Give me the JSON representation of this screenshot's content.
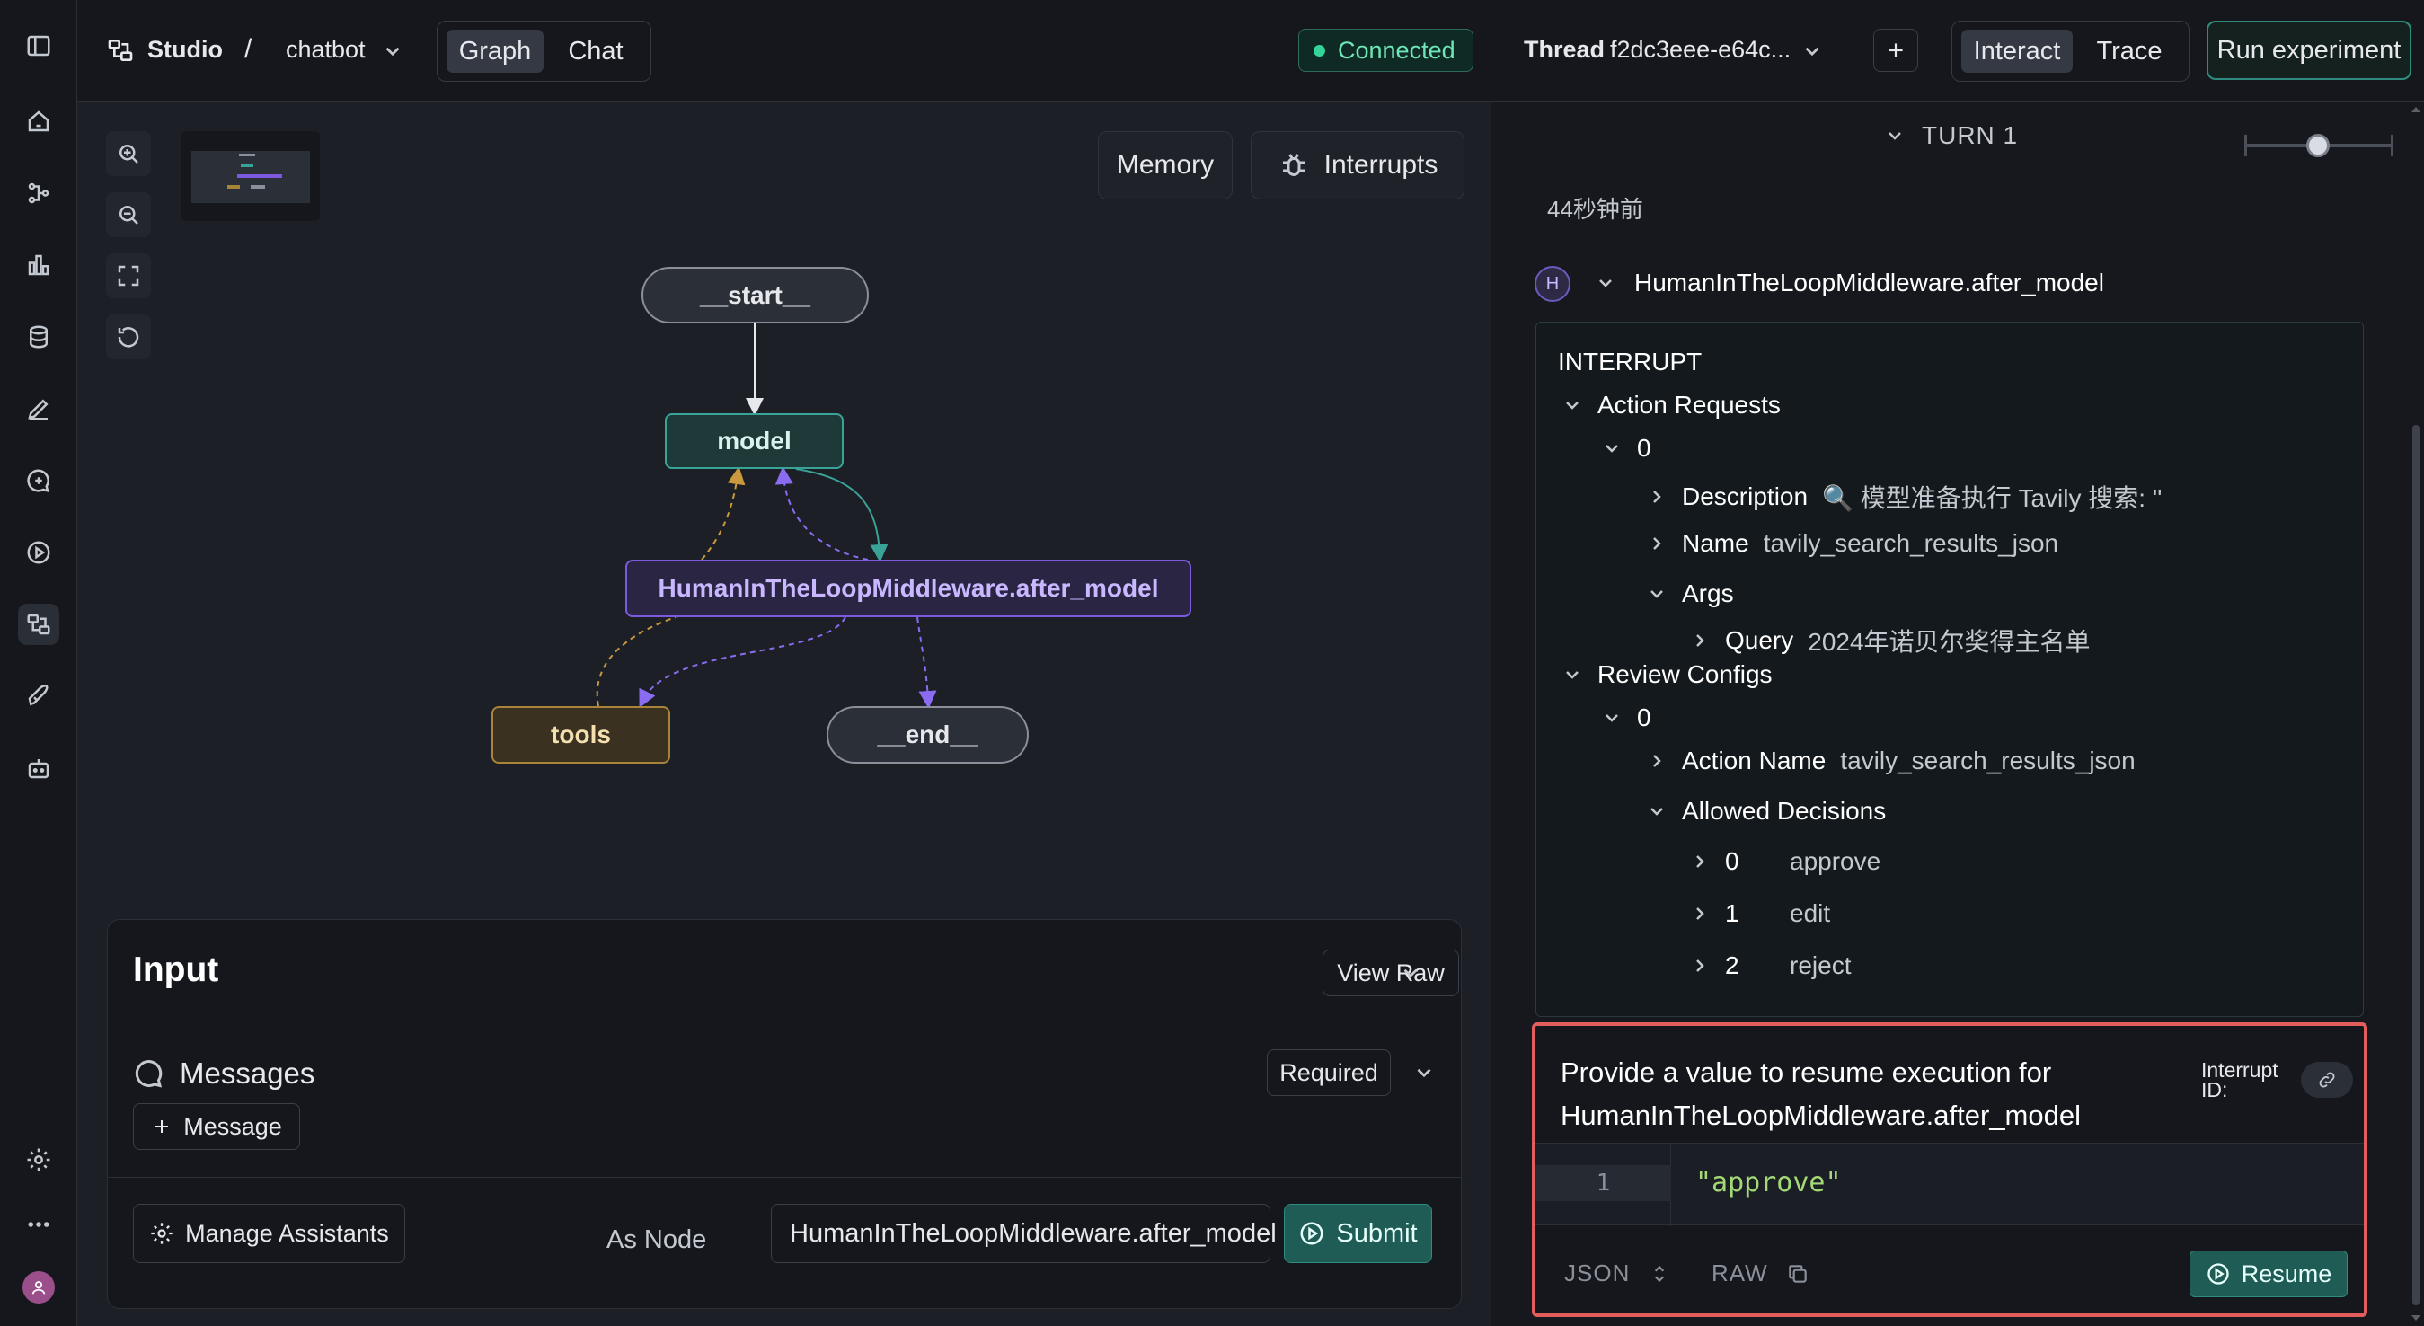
{
  "header": {
    "studio_label": "Studio",
    "separator": "/",
    "project_name": "chatbot",
    "tabs": [
      {
        "label": "Graph",
        "active": true
      },
      {
        "label": "Chat",
        "active": false
      }
    ],
    "connection_status": "Connected",
    "thread_label": "Thread",
    "thread_id": "f2dc3eee-e64c...",
    "mode_tabs": [
      {
        "label": "Interact",
        "active": true
      },
      {
        "label": "Trace",
        "active": false
      }
    ],
    "run_experiment_label": "Run experiment"
  },
  "sidebar": {
    "items": [
      {
        "icon": "panel-toggle-icon"
      },
      {
        "icon": "home-icon"
      },
      {
        "icon": "flow-icon"
      },
      {
        "icon": "chart-icon"
      },
      {
        "icon": "database-icon"
      },
      {
        "icon": "pen-icon"
      },
      {
        "icon": "chat-plus-icon"
      },
      {
        "icon": "play-icon"
      },
      {
        "icon": "studio-icon",
        "active": true
      },
      {
        "icon": "rocket-icon"
      },
      {
        "icon": "bot-icon"
      },
      {
        "icon": "settings-icon"
      },
      {
        "icon": "more-icon"
      },
      {
        "icon": "user-avatar-icon"
      }
    ]
  },
  "canvas": {
    "memory_label": "Memory",
    "interrupts_label": "Interrupts",
    "nodes": {
      "start": "__start__",
      "model": "model",
      "hitl": "HumanInTheLoopMiddleware.after_model",
      "tools": "tools",
      "end": "__end__"
    }
  },
  "input_panel": {
    "title": "Input",
    "view_raw_label": "View Raw",
    "messages_label": "Messages",
    "required_label": "Required",
    "add_message_label": "Message",
    "manage_assistants_label": "Manage Assistants",
    "as_node_label": "As Node",
    "as_node_value": "HumanInTheLoopMiddleware.after_model",
    "submit_label": "Submit"
  },
  "right_panel": {
    "turn_label": "TURN 1",
    "time_ago": "44秒钟前",
    "avatar_letter": "H",
    "node_title": "HumanInTheLoopMiddleware.after_model",
    "interrupt": {
      "heading": "INTERRUPT",
      "action_requests_label": "Action Requests",
      "ar_index": "0",
      "description_key": "Description",
      "description_val": "🔍 模型准备执行 Tavily 搜索: ''",
      "name_key": "Name",
      "name_val": "tavily_search_results_json",
      "args_key": "Args",
      "query_key": "Query",
      "query_val": "2024年诺贝尔奖得主名单",
      "review_configs_label": "Review Configs",
      "rc_index": "0",
      "action_name_key": "Action Name",
      "action_name_val": "tavily_search_results_json",
      "allowed_decisions_label": "Allowed Decisions",
      "decisions": [
        {
          "index": "0",
          "value": "approve"
        },
        {
          "index": "1",
          "value": "edit"
        },
        {
          "index": "2",
          "value": "reject"
        }
      ]
    },
    "resume": {
      "title": "Provide a value to resume execution for HumanInTheLoopMiddleware.after_model",
      "interrupt_id_label": "Interrupt ID:",
      "line_number": "1",
      "code": "\"approve\"",
      "json_label": "JSON",
      "raw_label": "RAW",
      "resume_label": "Resume"
    }
  },
  "colors": {
    "accent_teal": "#1f5c55",
    "connected_green": "#34d399",
    "hitl_purple": "#7c5ae0",
    "tools_amber": "#a8833a",
    "highlight_red": "#e35d5d"
  }
}
